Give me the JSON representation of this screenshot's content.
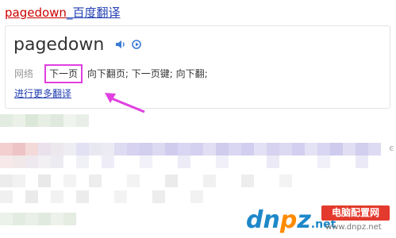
{
  "result": {
    "title_keyword": "pagedown",
    "title_rest": "_百度翻译"
  },
  "card": {
    "word": "pagedown",
    "source_label": "网络",
    "highlight_term": "下一页",
    "other_terms": "向下翻页; 下一页键; 向下翻;",
    "more_link": "进行更多翻译"
  },
  "watermark": {
    "logo_left": "dn",
    "logo_o": "p",
    "logo_right": "z",
    "domain": ".net",
    "badge": "电脑配置网",
    "url": "www.dnpz.net"
  },
  "edge_text": "ϵ",
  "colors": {
    "annotation": "#e040e0",
    "link": "#2440b3",
    "keyword": "#cc0000"
  }
}
